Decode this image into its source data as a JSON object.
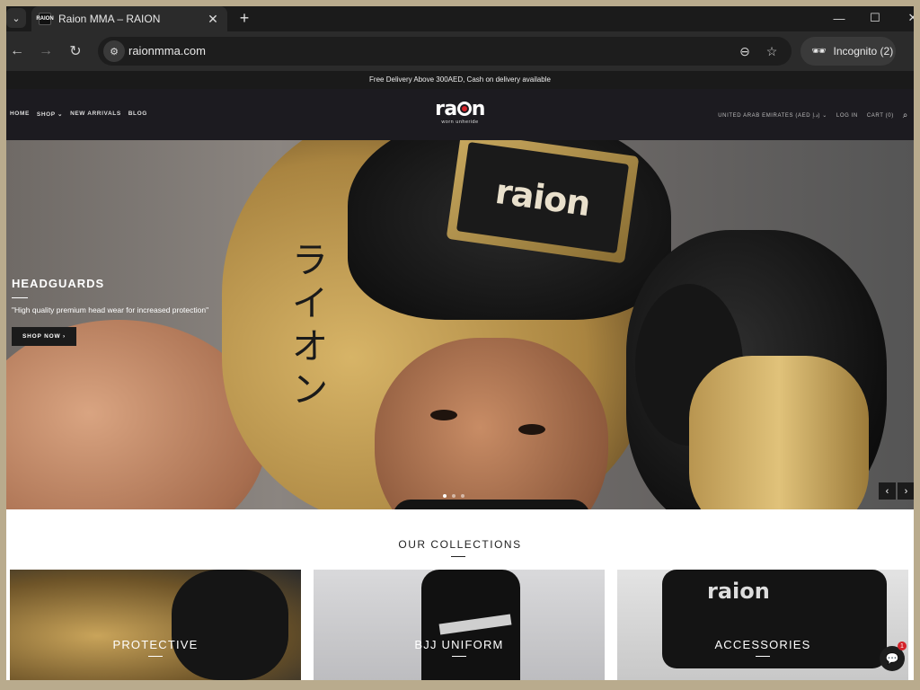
{
  "browser": {
    "tab_title": "Raion MMA – RAION",
    "favicon_text": "RAION",
    "url": "raionmma.com",
    "incognito_label": "Incognito (2)"
  },
  "site": {
    "announcement": "Free Delivery Above 300AED, Cash on delivery available",
    "nav": [
      "HOME",
      "SHOP",
      "NEW ARRIVALS",
      "BLOG"
    ],
    "logo_text": "raion",
    "logo_tagline": "worn unheride",
    "currency": "UNITED ARAB EMIRATES (AED د.إ)",
    "login": "LOG IN",
    "cart": "CART (0)"
  },
  "hero": {
    "title": "HEADGUARDS",
    "subtitle": "\"High quality premium head wear for increased protection\"",
    "button_label": "SHOP NOW",
    "badge_text": "raion",
    "japanese_text": "ライオン",
    "slides_total": 3,
    "active_slide": 1
  },
  "collections": {
    "title": "OUR COLLECTIONS",
    "items": [
      {
        "label": "PROTECTIVE"
      },
      {
        "label": "BJJ UNIFORM"
      },
      {
        "label": "ACCESSORIES"
      }
    ]
  },
  "chat": {
    "badge": "1"
  },
  "colors": {
    "accent_red": "#d4232a",
    "header_bg": "#1c1b20"
  }
}
